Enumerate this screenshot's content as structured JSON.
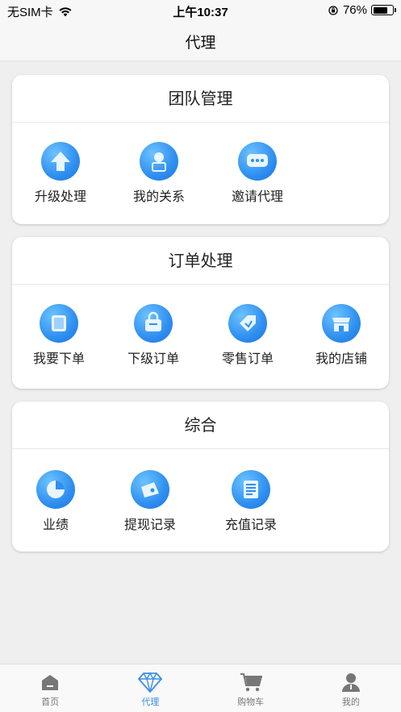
{
  "status_bar": {
    "carrier": "无SIM卡",
    "time": "上午10:37",
    "battery": "76%",
    "battery_level": 0.76
  },
  "nav": {
    "title": "代理"
  },
  "sections": [
    {
      "title": "团队管理",
      "items": [
        {
          "label": "升级处理",
          "icon": "upgrade-arrow-icon"
        },
        {
          "label": "我的关系",
          "icon": "relationship-person-icon"
        },
        {
          "label": "邀请代理",
          "icon": "invite-message-icon"
        }
      ]
    },
    {
      "title": "订单处理",
      "items": [
        {
          "label": "我要下单",
          "icon": "place-order-icon"
        },
        {
          "label": "下级订单",
          "icon": "subordinate-orders-bag-icon"
        },
        {
          "label": "零售订单",
          "icon": "retail-orders-tag-icon"
        },
        {
          "label": "我的店铺",
          "icon": "my-store-icon"
        }
      ]
    },
    {
      "title": "综合",
      "items": [
        {
          "label": "业绩",
          "icon": "performance-pie-icon"
        },
        {
          "label": "提现记录",
          "icon": "withdrawal-wallet-icon"
        },
        {
          "label": "充值记录",
          "icon": "recharge-list-icon"
        }
      ]
    }
  ],
  "tabs": [
    {
      "label": "首页",
      "icon": "home-icon",
      "active": false
    },
    {
      "label": "代理",
      "icon": "diamond-icon",
      "active": true
    },
    {
      "label": "购物车",
      "icon": "cart-icon",
      "active": false
    },
    {
      "label": "我的",
      "icon": "profile-icon",
      "active": false
    }
  ],
  "colors": {
    "accent": "#3a8ee6",
    "icon_gradient_light": "#6cc3ff",
    "icon_gradient_dark": "#1d73e2",
    "inactive_tab": "#777777"
  }
}
